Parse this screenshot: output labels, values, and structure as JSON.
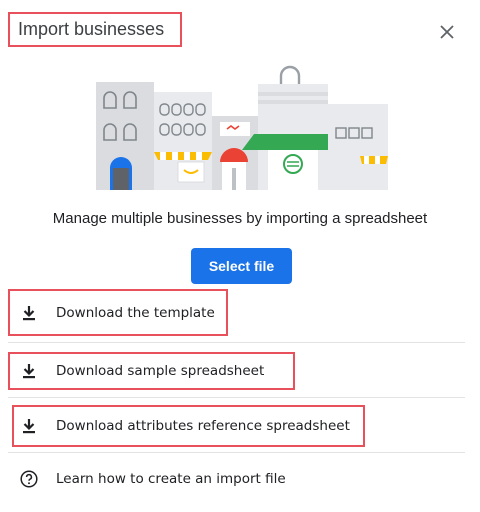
{
  "dialog": {
    "title": "Import businesses",
    "close_icon": "close-icon",
    "subtitle": "Manage multiple businesses by importing a spreadsheet",
    "select_file_label": "Select file",
    "accent_color": "#1a73e8",
    "highlight_color": "#e8505b"
  },
  "actions": [
    {
      "label": "Download the template",
      "icon": "download-icon"
    },
    {
      "label": "Download sample spreadsheet",
      "icon": "download-icon"
    },
    {
      "label": "Download attributes reference spreadsheet",
      "icon": "download-icon"
    },
    {
      "label": "Learn how to create an import file",
      "icon": "help-icon"
    }
  ]
}
